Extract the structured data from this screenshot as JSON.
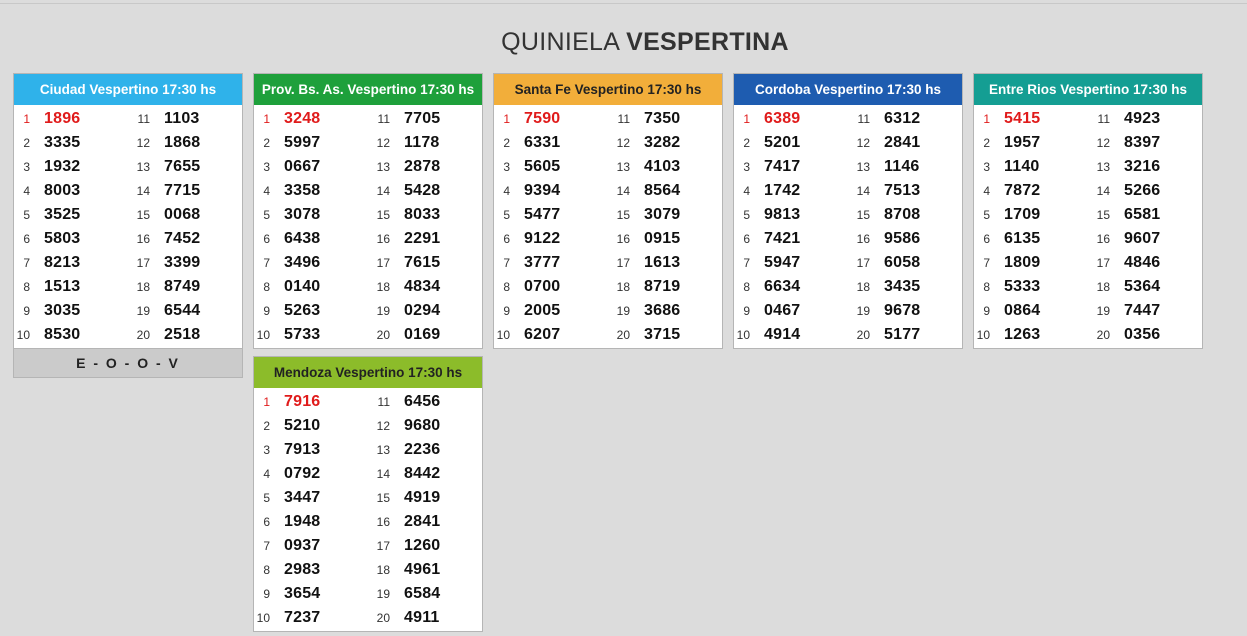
{
  "title": {
    "prefix": "QUINIELA",
    "bold": "VESPERTINA"
  },
  "boards": [
    {
      "id": "ciudad",
      "title": "Ciudad Vespertino 17:30 hs",
      "color": "#2fb2ea",
      "numbers": [
        "1896",
        "3335",
        "1932",
        "8003",
        "3525",
        "5803",
        "8213",
        "1513",
        "3035",
        "8530",
        "1103",
        "1868",
        "7655",
        "7715",
        "0068",
        "7452",
        "3399",
        "8749",
        "6544",
        "2518"
      ],
      "footer": "E - O - O - V"
    },
    {
      "id": "provincia",
      "title": "Prov. Bs. As. Vespertino 17:30 hs",
      "color": "#1ea03b",
      "numbers": [
        "3248",
        "5997",
        "0667",
        "3358",
        "3078",
        "6438",
        "3496",
        "0140",
        "5263",
        "5733",
        "7705",
        "1178",
        "2878",
        "5428",
        "8033",
        "2291",
        "7615",
        "4834",
        "0294",
        "0169"
      ]
    },
    {
      "id": "santa-fe",
      "title": "Santa Fe Vespertino 17:30 hs",
      "color": "#f2ae3a",
      "header_text_color": "#222222",
      "numbers": [
        "7590",
        "6331",
        "5605",
        "9394",
        "5477",
        "9122",
        "3777",
        "0700",
        "2005",
        "6207",
        "7350",
        "3282",
        "4103",
        "8564",
        "3079",
        "0915",
        "1613",
        "8719",
        "3686",
        "3715"
      ]
    },
    {
      "id": "cordoba",
      "title": "Cordoba Vespertino 17:30 hs",
      "color": "#1e5cb0",
      "numbers": [
        "6389",
        "5201",
        "7417",
        "1742",
        "9813",
        "7421",
        "5947",
        "6634",
        "0467",
        "4914",
        "6312",
        "2841",
        "1146",
        "7513",
        "8708",
        "9586",
        "6058",
        "3435",
        "9678",
        "5177"
      ]
    },
    {
      "id": "entre-rios",
      "title": "Entre Rios Vespertino 17:30 hs",
      "color": "#149e93",
      "numbers": [
        "5415",
        "1957",
        "1140",
        "7872",
        "1709",
        "6135",
        "1809",
        "5333",
        "0864",
        "1263",
        "4923",
        "8397",
        "3216",
        "5266",
        "6581",
        "9607",
        "4846",
        "5364",
        "7447",
        "0356"
      ]
    },
    {
      "id": "mendoza",
      "title": "Mendoza Vespertino 17:30 hs",
      "color": "#8cbc2a",
      "header_text_color": "#222222",
      "numbers": [
        "7916",
        "5210",
        "7913",
        "0792",
        "3447",
        "1948",
        "0937",
        "2983",
        "3654",
        "7237",
        "6456",
        "9680",
        "2236",
        "8442",
        "4919",
        "2841",
        "1260",
        "4961",
        "6584",
        "4911"
      ]
    }
  ]
}
